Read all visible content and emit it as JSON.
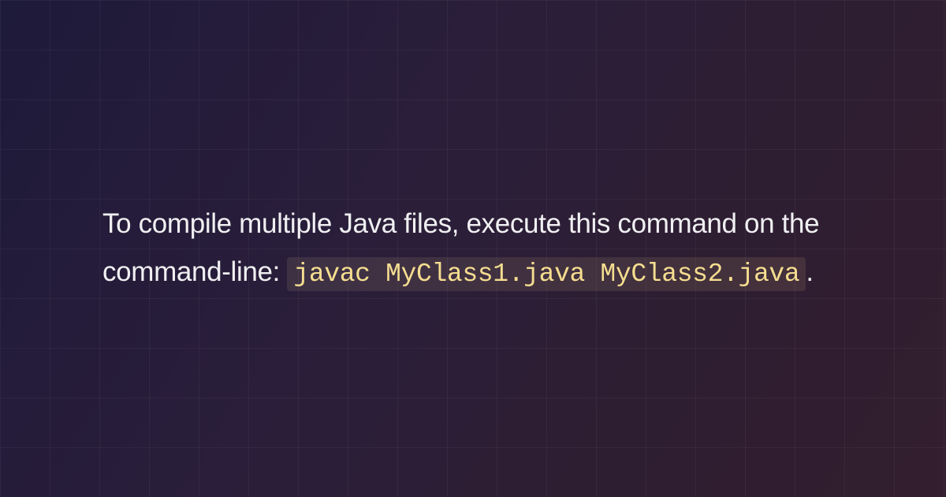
{
  "content": {
    "prose_part1": "To compile multiple Java files, execute this command on the command-line: ",
    "code": "javac MyClass1.java MyClass2.java",
    "prose_part2": "."
  }
}
